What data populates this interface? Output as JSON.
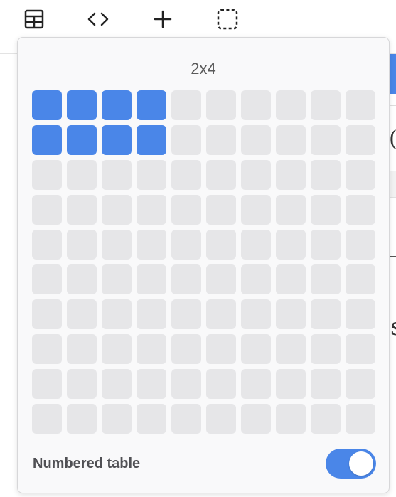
{
  "toolbar": {
    "buttons": [
      {
        "icon": "table-icon"
      },
      {
        "icon": "code-icon"
      },
      {
        "icon": "plus-icon"
      },
      {
        "icon": "selection-icon"
      }
    ]
  },
  "table_picker": {
    "size_label": "2x4",
    "total_rows": 10,
    "total_cols": 10,
    "selected_rows": 2,
    "selected_cols": 4,
    "numbered_table_label": "Numbered table",
    "numbered_table_enabled": true
  },
  "colors": {
    "accent": "#4a86e8",
    "cell_inactive": "#e6e6e8",
    "popup_bg": "#f9f9fa"
  }
}
